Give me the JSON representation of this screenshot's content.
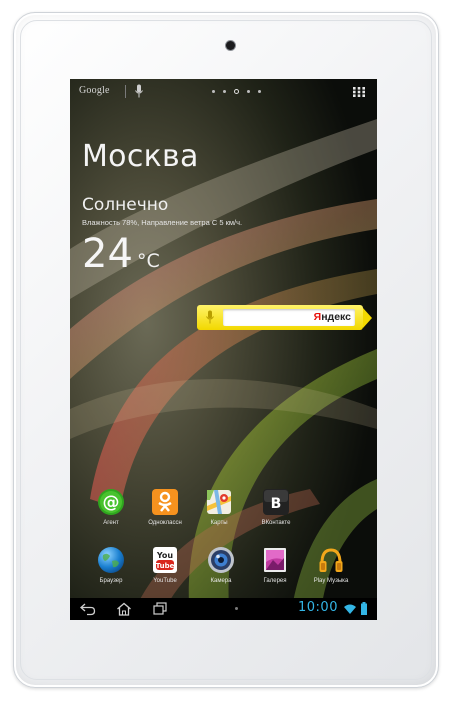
{
  "device": {
    "camera": "front-camera"
  },
  "topbar": {
    "search_label": "Google",
    "voice_icon": "mic-icon",
    "apps_icon": "all-apps-grid-icon"
  },
  "weather": {
    "city": "Москва",
    "condition": "Солнечно",
    "details": "Влажность 78%, Направление ветра С 5 км/ч.",
    "temperature": "24",
    "unit": "°C"
  },
  "yandex": {
    "logo_first": "Я",
    "logo_rest": "ндекс",
    "mic_icon": "mic-icon"
  },
  "apps": [
    {
      "label": "Агент",
      "icon": "at-sign-icon"
    },
    {
      "label": "Одноклассн",
      "icon": "odnoklassniki-icon"
    },
    {
      "label": "Карты",
      "icon": "maps-icon"
    },
    {
      "label": "ВКонтакте",
      "icon": "vk-icon"
    },
    {
      "label": "Браузер",
      "icon": "globe-icon"
    },
    {
      "label": "YouTube",
      "icon": "youtube-icon"
    },
    {
      "label": "Камера",
      "icon": "camera-lens-icon"
    },
    {
      "label": "Галерея",
      "icon": "gallery-icon"
    },
    {
      "label": "Play Музыка",
      "icon": "headphones-icon"
    }
  ],
  "navbar": {
    "time": "10:00",
    "back_icon": "back-icon",
    "home_icon": "home-icon",
    "recents_icon": "recents-icon",
    "wifi_icon": "wifi-icon",
    "battery_icon": "battery-icon"
  },
  "colors": {
    "accent": "#33b5e5",
    "yandex_yellow": "#f2d800",
    "yandex_red": "#e8120c",
    "bezel": "#f1f2f4"
  }
}
